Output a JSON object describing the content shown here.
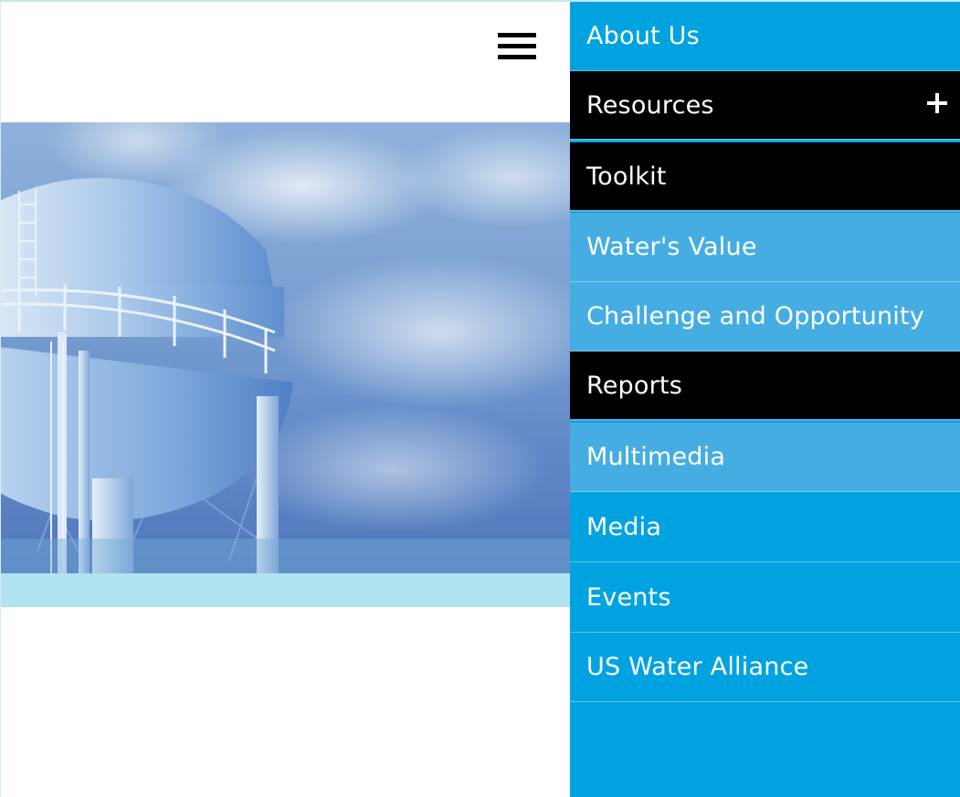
{
  "header": {
    "menu_icon": "hamburger-menu-icon"
  },
  "hero": {
    "image": "water-tower-photo"
  },
  "nav": {
    "items": [
      {
        "label": "About Us"
      },
      {
        "label": "Resources",
        "expand_icon": "plus-icon"
      },
      {
        "label": "Toolkit"
      },
      {
        "label": "Water's Value"
      },
      {
        "label": "Challenge and Opportunity"
      },
      {
        "label": "Reports"
      },
      {
        "label": "Multimedia"
      },
      {
        "label": "Media"
      },
      {
        "label": "Events"
      },
      {
        "label": "US Water Alliance"
      }
    ]
  },
  "colors": {
    "nav_primary": "#00a3e0",
    "nav_secondary": "#45ade2",
    "nav_active": "#000000",
    "strip": "#b1e3f0"
  }
}
